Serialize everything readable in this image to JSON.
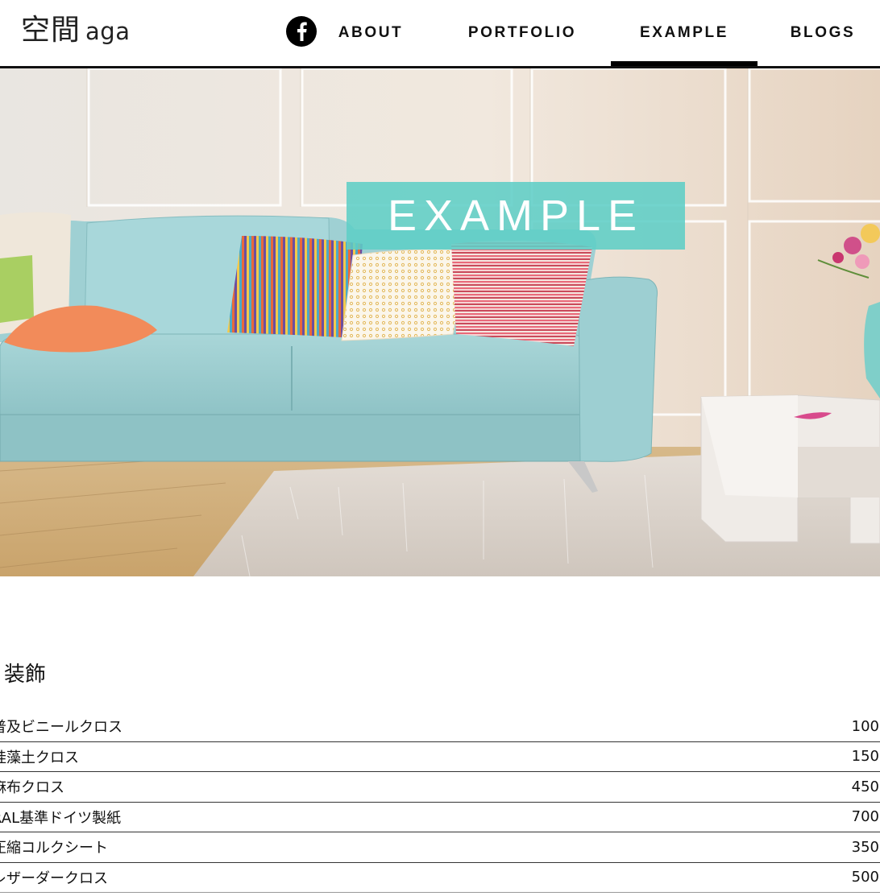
{
  "header": {
    "logo_kanji": "空間",
    "logo_roman": "aga",
    "facebook_icon": "facebook-icon",
    "nav": [
      {
        "label": "ABOUT",
        "active": false
      },
      {
        "label": "PORTFOLIO",
        "active": false
      },
      {
        "label": "EXAMPLE",
        "active": true
      },
      {
        "label": "BLOGS",
        "active": false
      }
    ]
  },
  "hero": {
    "title": "EXAMPLE",
    "banner_color": "#5ecec6",
    "image": "living-room-photo"
  },
  "section": {
    "title": "装飾",
    "rows": [
      {
        "name": "普及ビニールクロス",
        "value": "100"
      },
      {
        "name": "珪藻土クロス",
        "value": "150"
      },
      {
        "name": "麻布クロス",
        "value": "450"
      },
      {
        "name": "RAL基準ドイツ製紙",
        "value": "700"
      },
      {
        "name": "圧縮コルクシート",
        "value": "350"
      },
      {
        "name": "レザーダークロス",
        "value": "500"
      }
    ]
  }
}
